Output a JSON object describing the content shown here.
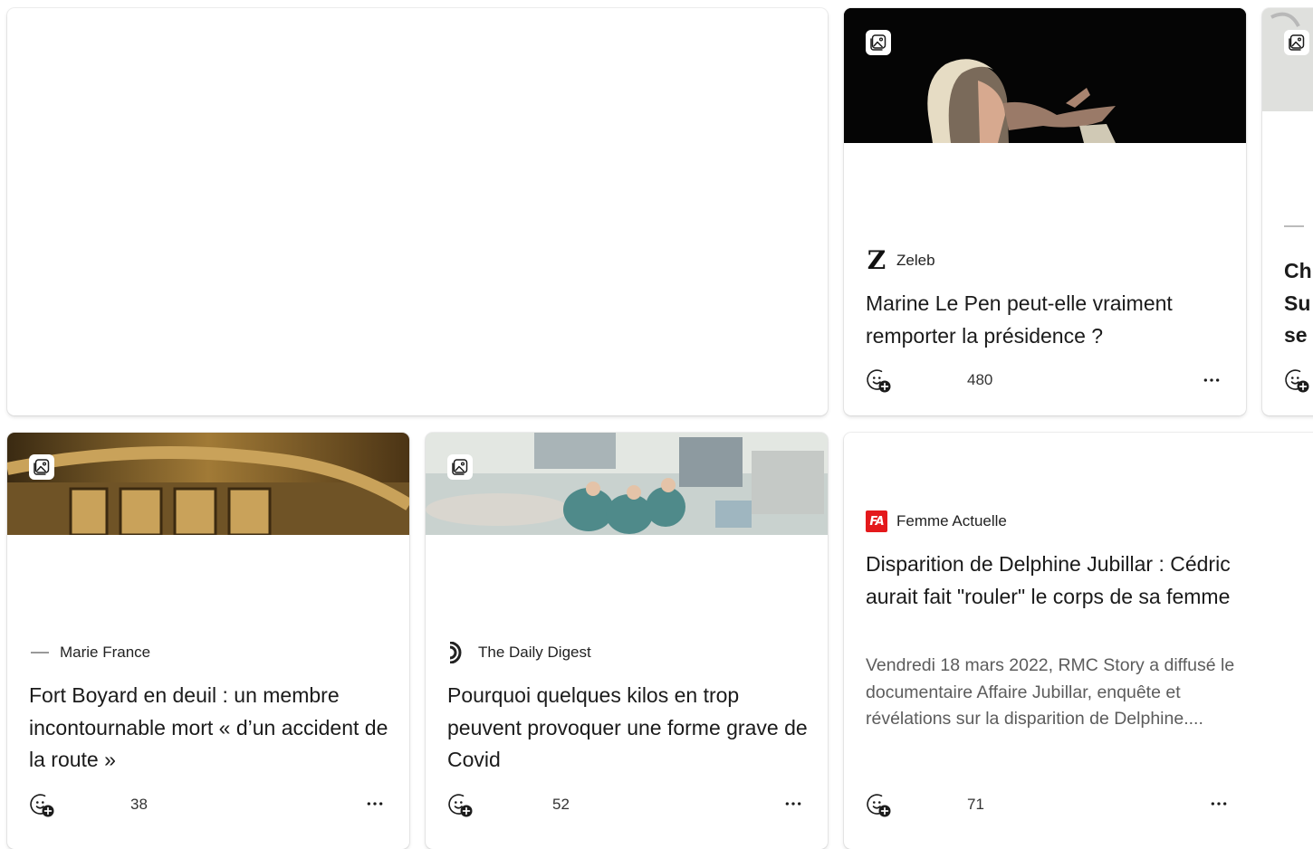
{
  "colors": {
    "text": "#1b1b1b",
    "secondary_text": "#5c5c5c",
    "femme_actuelle_red": "#e4191c"
  },
  "cards": [
    {
      "source": "Zeleb",
      "title": "Marine Le Pen peut-elle vraiment remporter la présidence ?",
      "reaction_count": "480",
      "image_icon": "image-gallery-icon"
    },
    {
      "source": "Marie France",
      "title": "Fort Boyard en deuil : un membre incontournable mort « d’un accident de la route »",
      "reaction_count": "38",
      "image_icon": "image-gallery-icon"
    },
    {
      "source": "The Daily Digest",
      "title": "Pourquoi quelques kilos en trop peuvent provoquer une forme grave de Covid",
      "reaction_count": "52",
      "image_icon": "image-gallery-icon"
    },
    {
      "source": "Femme Actuelle",
      "title": "Disparition de Delphine Jubillar : Cédric aurait fait \"rouler\" le corps de sa femme",
      "summary": "Vendredi 18 mars 2022, RMC Story a diffusé le documentaire Affaire Jubillar, enquête et révélations sur la disparition de Delphine....",
      "reaction_count": "71"
    },
    {
      "title_partial": "Ch Su se"
    }
  ],
  "logos": {
    "zeleb": "Z",
    "femme_actuelle": "FA"
  }
}
